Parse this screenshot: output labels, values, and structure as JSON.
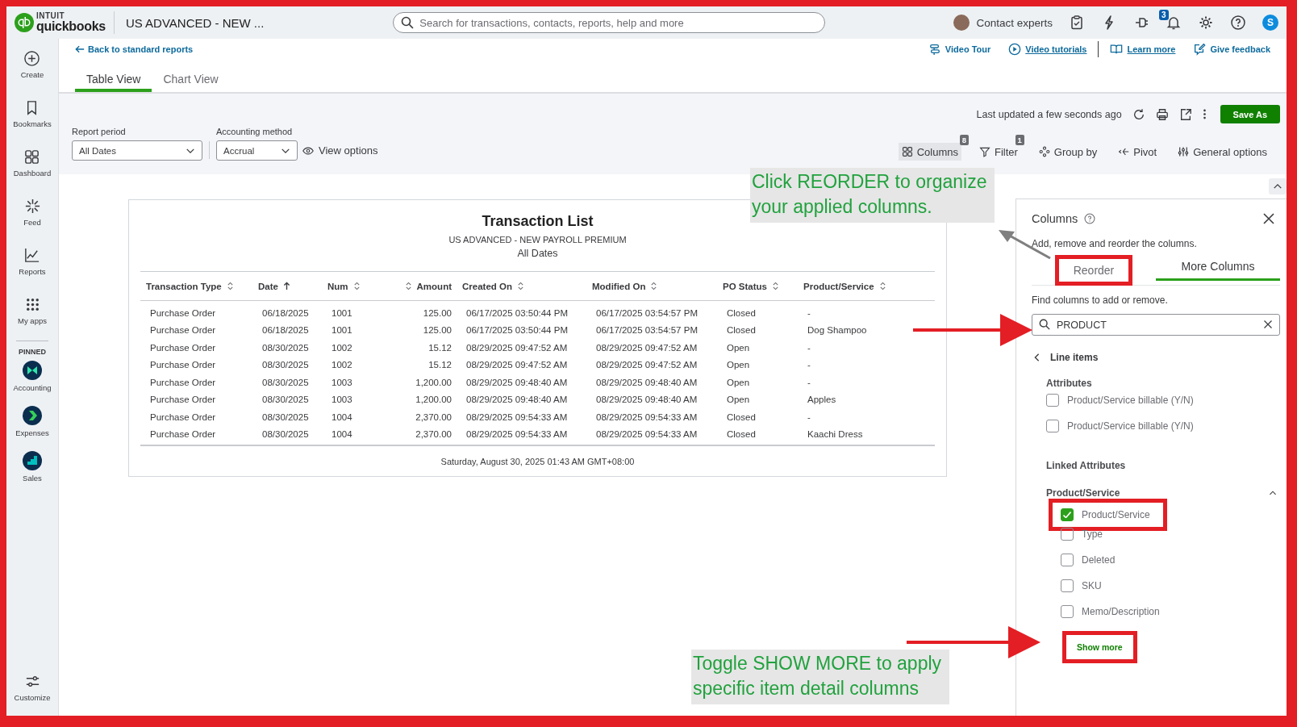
{
  "app": {
    "logo_top": "INTUIT",
    "logo_bottom": "quickbooks",
    "company": "US ADVANCED - NEW ...",
    "search_placeholder": "Search for transactions, contacts, reports, help and more",
    "contact": "Contact experts",
    "notification_count": "3",
    "avatar_letter": "S"
  },
  "sidebar": {
    "items": [
      {
        "kind": "create",
        "label": "Create"
      },
      {
        "kind": "bookmarks",
        "label": "Bookmarks"
      },
      {
        "kind": "dashboard",
        "label": "Dashboard"
      },
      {
        "kind": "feed",
        "label": "Feed"
      },
      {
        "kind": "reports",
        "label": "Reports"
      },
      {
        "kind": "apps",
        "label": "My apps"
      }
    ],
    "pinned_label": "PINNED",
    "pinned": [
      {
        "kind": "accounting",
        "label": "Accounting"
      },
      {
        "kind": "expenses",
        "label": "Expenses"
      },
      {
        "kind": "sales",
        "label": "Sales"
      }
    ],
    "customize": "Customize"
  },
  "back_link": "Back to standard reports",
  "help_links": [
    {
      "kind": "tour",
      "label": "Video Tour",
      "underlined": false
    },
    {
      "kind": "play",
      "label": "Video tutorials",
      "underlined": true
    },
    {
      "kind": "book",
      "label": "Learn more",
      "underlined": true
    },
    {
      "kind": "feedback",
      "label": "Give feedback",
      "underlined": false
    }
  ],
  "tabs": [
    {
      "label": "Table View",
      "selected": true
    },
    {
      "label": "Chart View",
      "selected": false
    }
  ],
  "last_updated": "Last updated a few seconds ago",
  "save_button": "Save As",
  "report_period": {
    "label": "Report period",
    "value": "All Dates"
  },
  "accounting_method": {
    "label": "Accounting method",
    "value": "Accrual"
  },
  "view_options": "View options",
  "report_actions": [
    {
      "kind": "columns",
      "label": "Columns",
      "badge": "8",
      "selected": true
    },
    {
      "kind": "filter",
      "label": "Filter",
      "badge": "1",
      "selected": false
    },
    {
      "kind": "group",
      "label": "Group by",
      "selected": false
    },
    {
      "kind": "pivot",
      "label": "Pivot",
      "selected": false
    },
    {
      "kind": "options",
      "label": "General options",
      "selected": false
    }
  ],
  "report": {
    "title": "Transaction List",
    "subtitle": "US ADVANCED - NEW PAYROLL PREMIUM",
    "period": "All Dates",
    "columns": [
      {
        "label": "Transaction Type",
        "sorted": false,
        "numeric": false
      },
      {
        "label": "Date",
        "sorted": true,
        "numeric": false
      },
      {
        "label": "Num",
        "sorted": false,
        "numeric": false
      },
      {
        "label": "Amount",
        "sorted": false,
        "numeric": true
      },
      {
        "label": "Created On",
        "sorted": false,
        "numeric": false
      },
      {
        "label": "Modified On",
        "sorted": false,
        "numeric": false
      },
      {
        "label": "PO Status",
        "sorted": false,
        "numeric": false
      },
      {
        "label": "Product/Service",
        "sorted": false,
        "numeric": false
      }
    ],
    "rows": [
      [
        "Purchase Order",
        "06/18/2025",
        "1001",
        "125.00",
        "06/17/2025 03:50:44 PM",
        "06/17/2025 03:54:57 PM",
        "Closed",
        "-"
      ],
      [
        "Purchase Order",
        "06/18/2025",
        "1001",
        "125.00",
        "06/17/2025 03:50:44 PM",
        "06/17/2025 03:54:57 PM",
        "Closed",
        "Dog Shampoo"
      ],
      [
        "Purchase Order",
        "08/30/2025",
        "1002",
        "15.12",
        "08/29/2025 09:47:52 AM",
        "08/29/2025 09:47:52 AM",
        "Open",
        "-"
      ],
      [
        "Purchase Order",
        "08/30/2025",
        "1002",
        "15.12",
        "08/29/2025 09:47:52 AM",
        "08/29/2025 09:47:52 AM",
        "Open",
        "-"
      ],
      [
        "Purchase Order",
        "08/30/2025",
        "1003",
        "1,200.00",
        "08/29/2025 09:48:40 AM",
        "08/29/2025 09:48:40 AM",
        "Open",
        "-"
      ],
      [
        "Purchase Order",
        "08/30/2025",
        "1003",
        "1,200.00",
        "08/29/2025 09:48:40 AM",
        "08/29/2025 09:48:40 AM",
        "Open",
        "Apples"
      ],
      [
        "Purchase Order",
        "08/30/2025",
        "1004",
        "2,370.00",
        "08/29/2025 09:54:33 AM",
        "08/29/2025 09:54:33 AM",
        "Closed",
        "-"
      ],
      [
        "Purchase Order",
        "08/30/2025",
        "1004",
        "2,370.00",
        "08/29/2025 09:54:33 AM",
        "08/29/2025 09:54:33 AM",
        "Closed",
        "Kaachi Dress"
      ]
    ],
    "footer": "Saturday, August 30, 2025 01:43 AM GMT+08:00"
  },
  "panel": {
    "title": "Columns",
    "description": "Add, remove and reorder the columns.",
    "tabs": [
      {
        "label": "Reorder",
        "selected": false,
        "highlighted": true
      },
      {
        "label": "More Columns",
        "selected": true,
        "highlighted": false
      }
    ],
    "find_hint": "Find columns to add or remove.",
    "search_value": "PRODUCT",
    "back_label": "Line items",
    "sections": [
      {
        "kind": "group",
        "title": "Attributes",
        "items": [
          {
            "label": "Product/Service billable (Y/N)",
            "checked": false,
            "highlighted": false
          },
          {
            "label": "Product/Service billable (Y/N)",
            "checked": false,
            "highlighted": false
          }
        ]
      },
      {
        "kind": "heading",
        "title": "Linked Attributes"
      },
      {
        "kind": "collapsible",
        "title": "Product/Service",
        "expanded": true,
        "items": [
          {
            "label": "Product/Service",
            "checked": true,
            "highlighted": true
          },
          {
            "label": "Type",
            "checked": false,
            "highlighted": false
          },
          {
            "label": "Deleted",
            "checked": false,
            "highlighted": false
          },
          {
            "label": "SKU",
            "checked": false,
            "highlighted": false
          },
          {
            "label": "Memo/Description",
            "checked": false,
            "highlighted": false
          }
        ]
      }
    ],
    "show_more": {
      "label": "Show more",
      "highlighted": true
    }
  },
  "callouts": [
    {
      "lines": [
        "Click REORDER to organize",
        "your applied columns."
      ]
    },
    {
      "lines": [
        "Toggle SHOW MORE to apply",
        "specific item detail columns"
      ]
    }
  ]
}
